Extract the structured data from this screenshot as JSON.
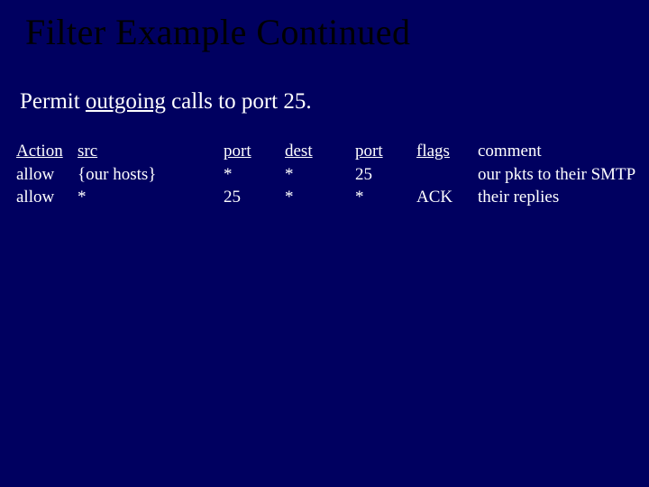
{
  "title": "Filter Example Continued",
  "description_prefix": "Permit ",
  "description_outgoing": "outgoing",
  "description_suffix": " calls to port 25.",
  "headers": {
    "action": "Action",
    "src": "src",
    "port1": "port",
    "dest": "dest",
    "port2": "port",
    "flags": "flags",
    "comment": "comment"
  },
  "rows": [
    {
      "action": "allow",
      "src": "{our hosts}",
      "port1": "*",
      "dest": "*",
      "port2": "25",
      "flags": "",
      "comment": "  our pkts to their SMTP"
    },
    {
      "action": "allow",
      "src": "*",
      "port1": "25",
      "dest": "*",
      "port2": "*",
      "flags": "ACK",
      "comment": "their replies"
    }
  ]
}
